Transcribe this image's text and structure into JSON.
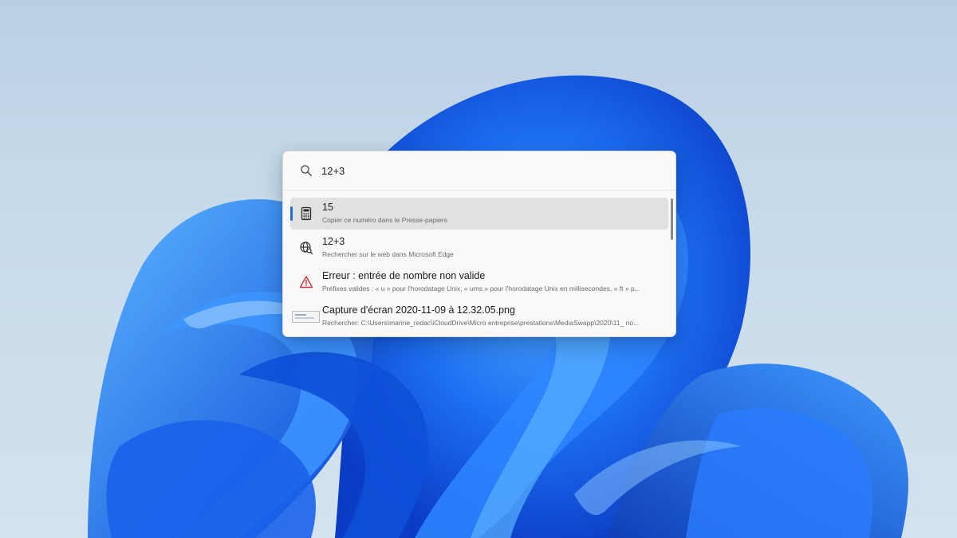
{
  "search": {
    "query": "12+3",
    "icon": "search-icon"
  },
  "results": [
    {
      "icon": "calculator-icon",
      "title": "15",
      "subtitle": "Copier ce numéro dans le Presse-papiers",
      "selected": true
    },
    {
      "icon": "web-search-icon",
      "title": "12+3",
      "subtitle": "Rechercher sur le web dans Microsoft Edge",
      "selected": false
    },
    {
      "icon": "warning-icon",
      "title": "Erreur : entrée de nombre non valide",
      "subtitle": "Préfixes valides : « u » pour l'horodatage Unix, « ums » pour l'horodatage Unix en millisecondes, « ft » p...",
      "selected": false
    },
    {
      "icon": "file-thumbnail-icon",
      "title": "Capture d'écran 2020-11-09 à 12.32.05.png",
      "subtitle": "Rechercher: C:\\Users\\marine_redac\\iCloudDrive\\Micro entreprise\\prestations\\MediaSwapp\\2020\\11_ no...",
      "selected": false
    }
  ],
  "colors": {
    "accent": "#1f6fd1",
    "selection_background": "#e1e1e1",
    "warning": "#d13438",
    "wallpaper_blue": "#1a5fe0"
  }
}
